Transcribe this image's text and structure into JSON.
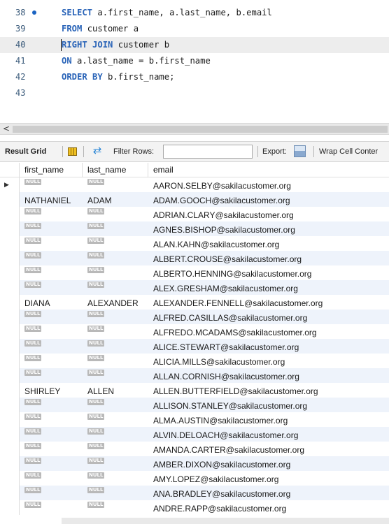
{
  "editor": {
    "lines": [
      {
        "num": "38",
        "kw": "SELECT",
        "rest": " a.first_name, a.last_name, b.email",
        "has_dot": true
      },
      {
        "num": "39",
        "kw": "FROM",
        "rest": " customer a",
        "has_dot": false
      },
      {
        "num": "40",
        "kw": "RIGHT JOIN",
        "rest": " customer b",
        "has_dot": false
      },
      {
        "num": "41",
        "kw": "ON",
        "rest": " a.last_name = b.first_name",
        "has_dot": false
      },
      {
        "num": "42",
        "kw": "ORDER BY",
        "rest": " b.first_name;",
        "has_dot": false
      },
      {
        "num": "43",
        "kw": "",
        "rest": "",
        "has_dot": false
      }
    ]
  },
  "scrollbar": {
    "left_arrow": "<"
  },
  "toolbar": {
    "result_grid_label": "Result Grid",
    "filter_rows_label": "Filter Rows:",
    "filter_value": "",
    "export_label": "Export:",
    "wrap_label": "Wrap Cell Conter",
    "icons": [
      "grid-view-icon",
      "refresh-icon",
      "export-icon"
    ]
  },
  "grid": {
    "columns": [
      "first_name",
      "last_name",
      "email"
    ],
    "null_label": "NULL",
    "current_row_marker": "▶",
    "rows": [
      {
        "first_name": null,
        "last_name": null,
        "email": "AARON.SELBY@sakilacustomer.org"
      },
      {
        "first_name": "NATHANIEL",
        "last_name": "ADAM",
        "email": "ADAM.GOOCH@sakilacustomer.org"
      },
      {
        "first_name": null,
        "last_name": null,
        "email": "ADRIAN.CLARY@sakilacustomer.org"
      },
      {
        "first_name": null,
        "last_name": null,
        "email": "AGNES.BISHOP@sakilacustomer.org"
      },
      {
        "first_name": null,
        "last_name": null,
        "email": "ALAN.KAHN@sakilacustomer.org"
      },
      {
        "first_name": null,
        "last_name": null,
        "email": "ALBERT.CROUSE@sakilacustomer.org"
      },
      {
        "first_name": null,
        "last_name": null,
        "email": "ALBERTO.HENNING@sakilacustomer.org"
      },
      {
        "first_name": null,
        "last_name": null,
        "email": "ALEX.GRESHAM@sakilacustomer.org"
      },
      {
        "first_name": "DIANA",
        "last_name": "ALEXANDER",
        "email": "ALEXANDER.FENNELL@sakilacustomer.org"
      },
      {
        "first_name": null,
        "last_name": null,
        "email": "ALFRED.CASILLAS@sakilacustomer.org"
      },
      {
        "first_name": null,
        "last_name": null,
        "email": "ALFREDO.MCADAMS@sakilacustomer.org"
      },
      {
        "first_name": null,
        "last_name": null,
        "email": "ALICE.STEWART@sakilacustomer.org"
      },
      {
        "first_name": null,
        "last_name": null,
        "email": "ALICIA.MILLS@sakilacustomer.org"
      },
      {
        "first_name": null,
        "last_name": null,
        "email": "ALLAN.CORNISH@sakilacustomer.org"
      },
      {
        "first_name": "SHIRLEY",
        "last_name": "ALLEN",
        "email": "ALLEN.BUTTERFIELD@sakilacustomer.org"
      },
      {
        "first_name": null,
        "last_name": null,
        "email": "ALLISON.STANLEY@sakilacustomer.org"
      },
      {
        "first_name": null,
        "last_name": null,
        "email": "ALMA.AUSTIN@sakilacustomer.org"
      },
      {
        "first_name": null,
        "last_name": null,
        "email": "ALVIN.DELOACH@sakilacustomer.org"
      },
      {
        "first_name": null,
        "last_name": null,
        "email": "AMANDA.CARTER@sakilacustomer.org"
      },
      {
        "first_name": null,
        "last_name": null,
        "email": "AMBER.DIXON@sakilacustomer.org"
      },
      {
        "first_name": null,
        "last_name": null,
        "email": "AMY.LOPEZ@sakilacustomer.org"
      },
      {
        "first_name": null,
        "last_name": null,
        "email": "ANA.BRADLEY@sakilacustomer.org"
      },
      {
        "first_name": null,
        "last_name": null,
        "email": "ANDRE.RAPP@sakilacustomer.org"
      }
    ]
  }
}
